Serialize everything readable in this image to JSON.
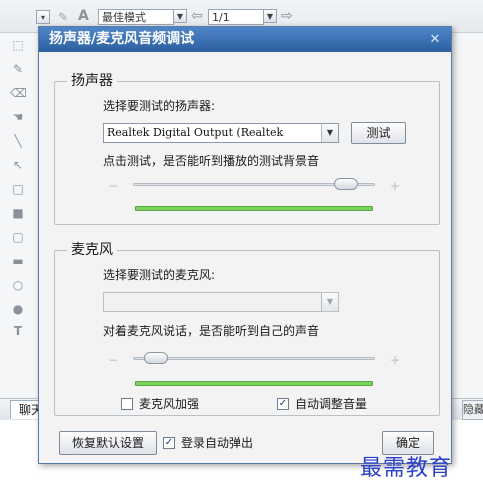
{
  "background_app": {
    "toolbar": {
      "mode_select": "最佳模式",
      "page_select": "1/1"
    },
    "chat_tab_label": "聊天",
    "hide_button_label": "隐藏"
  },
  "dialog": {
    "title": "扬声器/麦克风音频调试",
    "speaker": {
      "group_title": "扬声器",
      "select_label": "选择要测试的扬声器:",
      "device_value": "Realtek Digital Output (Realtek",
      "test_button": "测试",
      "hint": "点击测试，是否能听到播放的测试背景音",
      "volume_level": 0.92
    },
    "mic": {
      "group_title": "麦克风",
      "select_label": "选择要测试的麦克风:",
      "device_value": "",
      "hint": "对着麦克风说话，是否能听到自己的声音",
      "volume_level": 0.05,
      "boost_label": "麦克风加强",
      "boost_checked": false,
      "auto_adjust_label": "自动调整音量",
      "auto_adjust_checked": true
    },
    "footer": {
      "restore_button": "恢复默认设置",
      "auto_popup_label": "登录自动弹出",
      "auto_popup_checked": true,
      "ok_button": "确定"
    }
  },
  "watermark": "最需教育",
  "colors": {
    "titlebar": "#2b5f9f",
    "meter_green": "#7ad35d",
    "watermark": "#2b3fc8"
  }
}
